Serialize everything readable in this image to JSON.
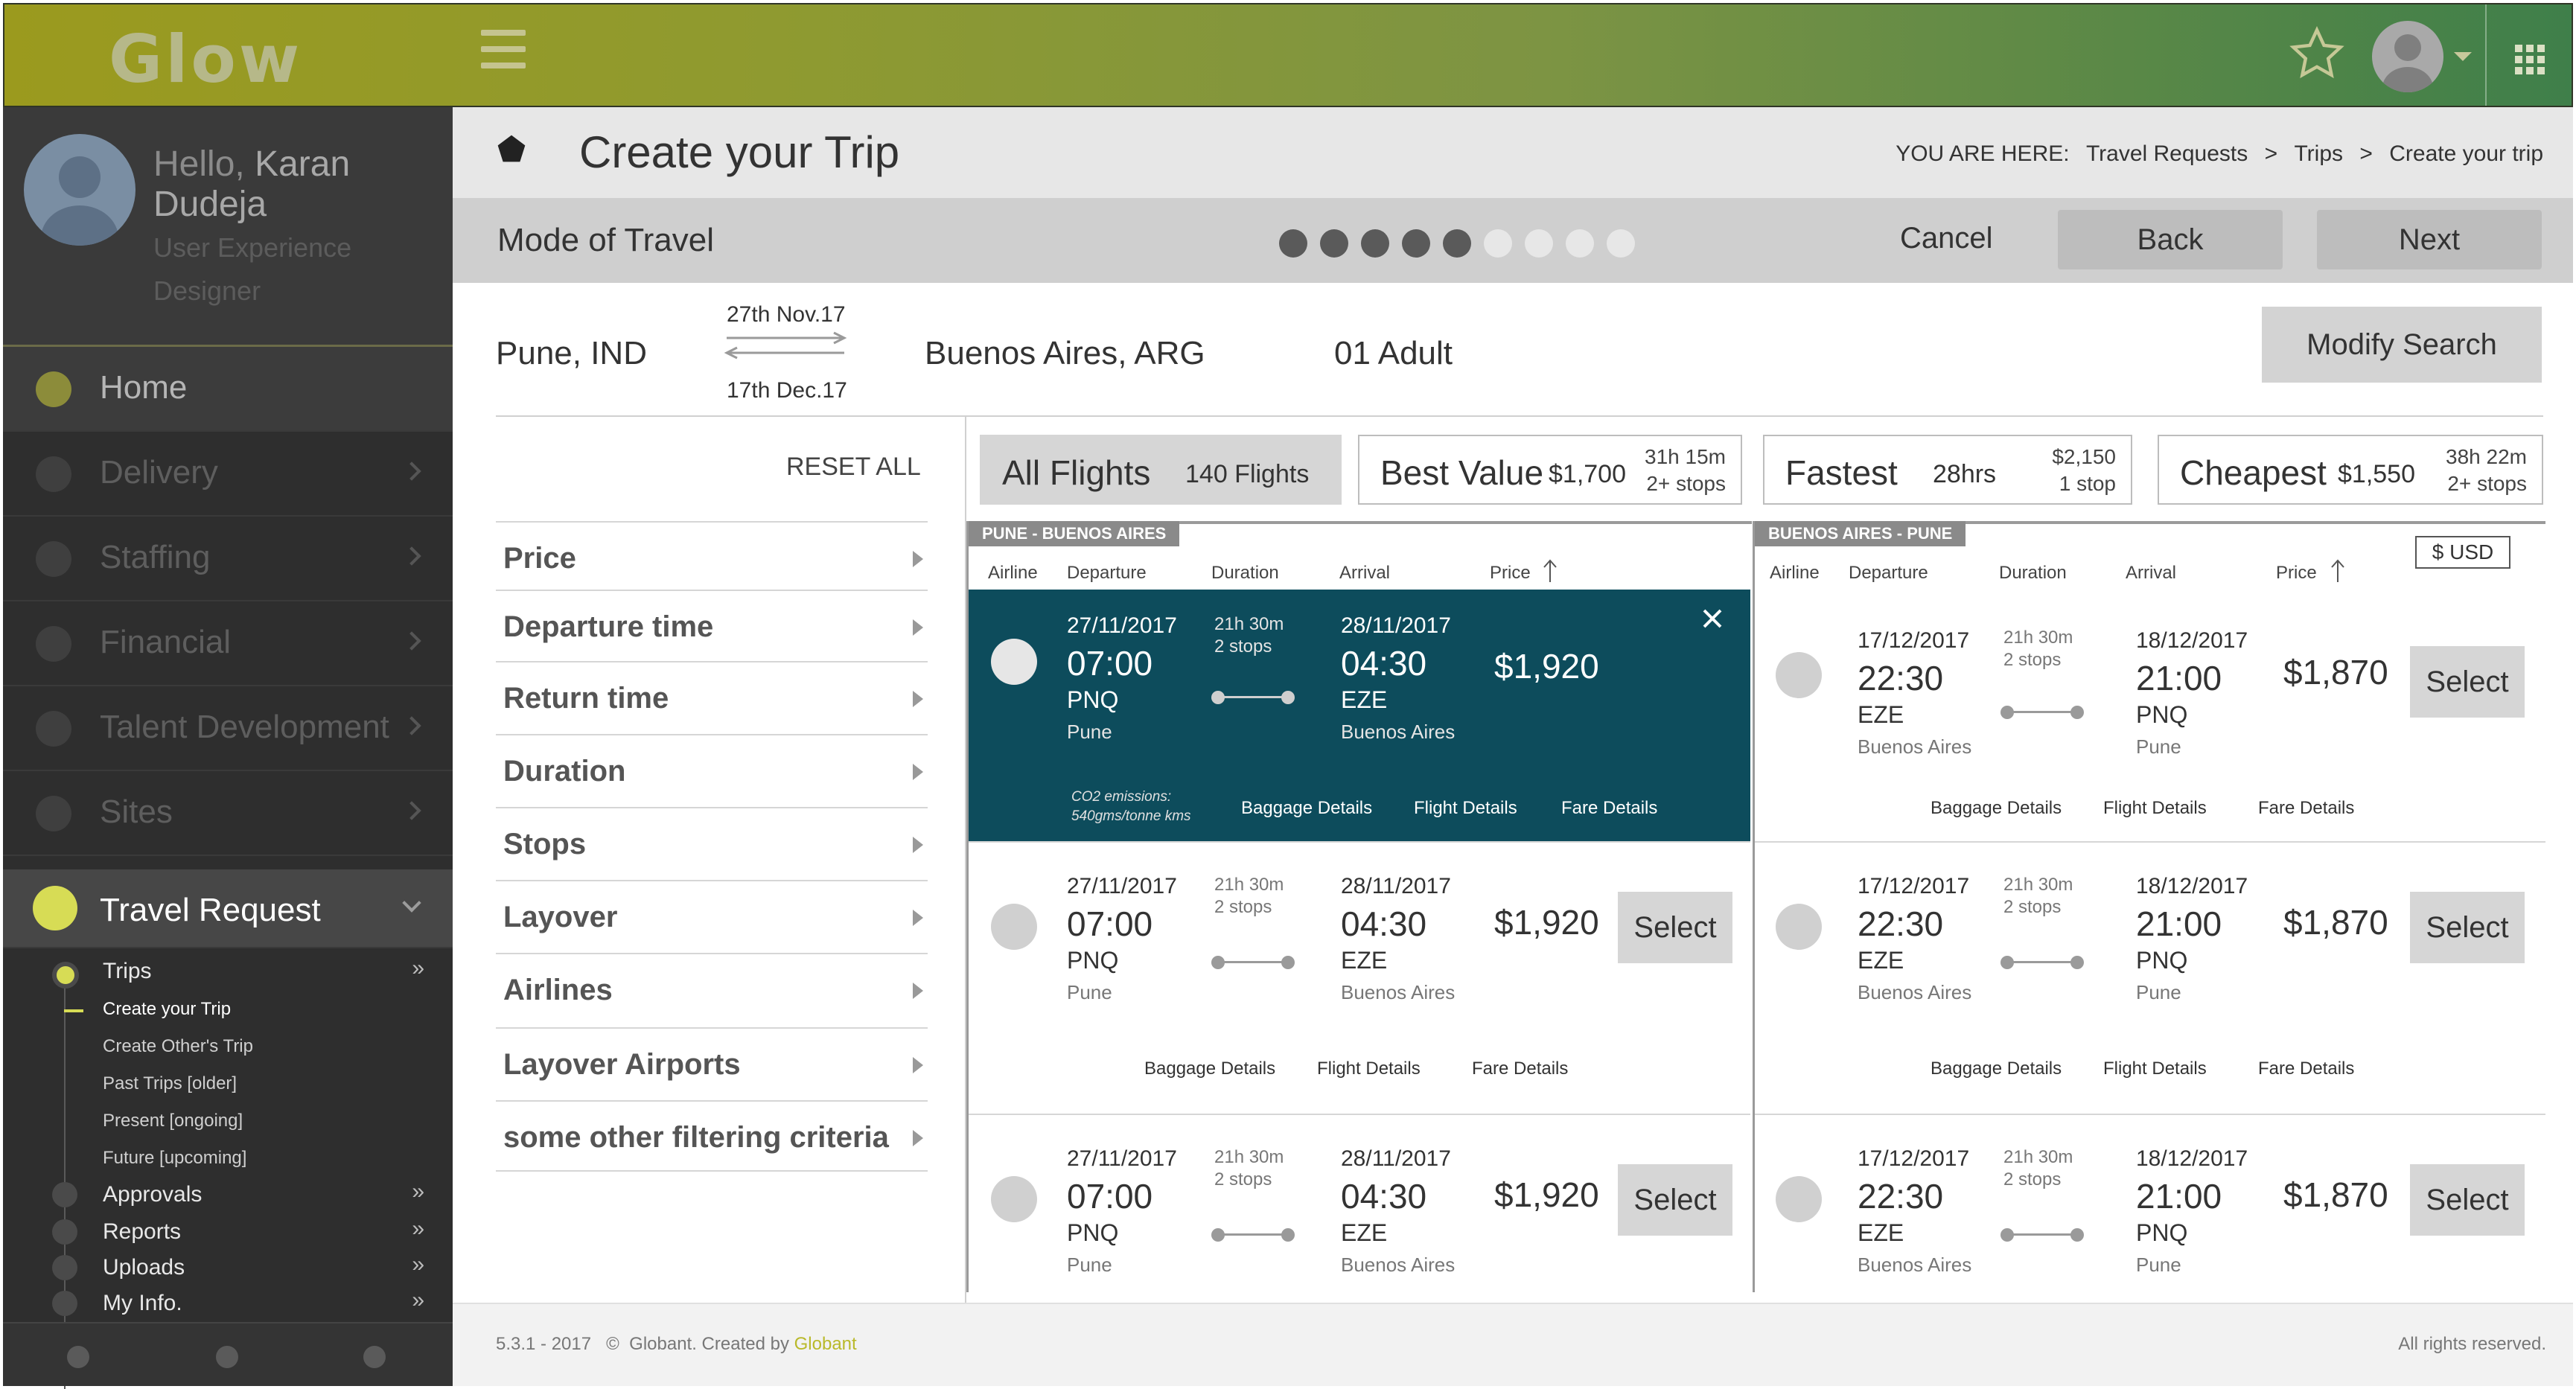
{
  "app": {
    "logo": "Glow"
  },
  "topbar": {
    "icons": [
      "hamburger-icon",
      "star-icon",
      "avatar",
      "apps-grid-icon"
    ]
  },
  "sidebar": {
    "greeting": "Hello,",
    "user_name_first": "Karan",
    "user_name_last": "Dudeja",
    "user_role": "User Experience Designer",
    "nav": [
      {
        "label": "Home",
        "icon": "home-icon"
      },
      {
        "label": "Delivery",
        "icon": "send-icon"
      },
      {
        "label": "Staffing",
        "icon": "people-icon"
      },
      {
        "label": "Financial",
        "icon": "chart-icon"
      },
      {
        "label": "Talent Development",
        "icon": "graduation-icon"
      },
      {
        "label": "Sites",
        "icon": "pin-icon"
      },
      {
        "label": "Travel Request",
        "icon": "pentagon-icon"
      }
    ],
    "sub": {
      "trips": "Trips",
      "create_trip": "Create your Trip",
      "create_others": "Create Other's Trip",
      "past": "Past Trips [older]",
      "present": "Present [ongoing]",
      "future": "Future [upcoming]",
      "approvals": "Approvals",
      "reports": "Reports",
      "uploads": "Uploads",
      "myinfo": "My Info."
    }
  },
  "header": {
    "title": "Create your Trip",
    "crumb_label": "YOU ARE HERE:",
    "crumbs": [
      "Travel Requests",
      "Trips",
      "Create your trip"
    ],
    "crumb_sep": ">"
  },
  "mode": {
    "title": "Mode of Travel",
    "steps_total": 9,
    "steps_done": 5,
    "cancel": "Cancel",
    "back": "Back",
    "next": "Next"
  },
  "search": {
    "from": "Pune, IND",
    "to": "Buenos Aires, ARG",
    "depart_date": "27th Nov.17",
    "return_date": "17th Dec.17",
    "passengers": "01 Adult",
    "modify": "Modify Search"
  },
  "filters": {
    "reset": "RESET ALL",
    "items": [
      "Price",
      "Departure time",
      "Return time",
      "Duration",
      "Stops",
      "Layover",
      "Airlines",
      "Layover Airports",
      "some other filtering criteria"
    ]
  },
  "summary": {
    "all": {
      "label": "All Flights",
      "count": "140 Flights"
    },
    "best": {
      "label": "Best Value",
      "price": "$1,700",
      "duration": "31h 15m",
      "stops": "2+ stops"
    },
    "fastest": {
      "label": "Fastest",
      "duration": "28hrs",
      "price": "$2,150",
      "stops": "1 stop"
    },
    "cheapest": {
      "label": "Cheapest",
      "price": "$1,550",
      "duration": "38h 22m",
      "stops": "2+ stops"
    }
  },
  "columns": {
    "airline": "Airline",
    "departure": "Departure",
    "duration": "Duration",
    "arrival": "Arrival",
    "price": "Price"
  },
  "currency": "$ USD",
  "outbound": {
    "tag": "PUNE - BUENOS AIRES",
    "select": "Select",
    "links": {
      "baggage": "Baggage Details",
      "flight": "Flight Details",
      "fare": "Fare Details"
    },
    "co2_line1": "CO2 emissions:",
    "co2_line2": "540gms/tonne kms",
    "rows": [
      {
        "dep_date": "27/11/2017",
        "dep_time": "07:00",
        "dep_code": "PNQ",
        "dep_city": "Pune",
        "dur": "21h 30m",
        "stops": "2 stops",
        "arr_date": "28/11/2017",
        "arr_time": "04:30",
        "arr_code": "EZE",
        "arr_city": "Buenos Aires",
        "price": "$1,920"
      },
      {
        "dep_date": "27/11/2017",
        "dep_time": "07:00",
        "dep_code": "PNQ",
        "dep_city": "Pune",
        "dur": "21h 30m",
        "stops": "2 stops",
        "arr_date": "28/11/2017",
        "arr_time": "04:30",
        "arr_code": "EZE",
        "arr_city": "Buenos Aires",
        "price": "$1,920"
      },
      {
        "dep_date": "27/11/2017",
        "dep_time": "07:00",
        "dep_code": "PNQ",
        "dep_city": "Pune",
        "dur": "21h 30m",
        "stops": "2 stops",
        "arr_date": "28/11/2017",
        "arr_time": "04:30",
        "arr_code": "EZE",
        "arr_city": "Buenos Aires",
        "price": "$1,920"
      }
    ]
  },
  "inbound": {
    "tag": "BUENOS AIRES - PUNE",
    "select": "Select",
    "links": {
      "baggage": "Baggage Details",
      "flight": "Flight Details",
      "fare": "Fare Details"
    },
    "rows": [
      {
        "dep_date": "17/12/2017",
        "dep_time": "22:30",
        "dep_code": "EZE",
        "dep_city": "Buenos Aires",
        "dur": "21h 30m",
        "stops": "2 stops",
        "arr_date": "18/12/2017",
        "arr_time": "21:00",
        "arr_code": "PNQ",
        "arr_city": "Pune",
        "price": "$1,870"
      },
      {
        "dep_date": "17/12/2017",
        "dep_time": "22:30",
        "dep_code": "EZE",
        "dep_city": "Buenos Aires",
        "dur": "21h 30m",
        "stops": "2 stops",
        "arr_date": "18/12/2017",
        "arr_time": "21:00",
        "arr_code": "PNQ",
        "arr_city": "Pune",
        "price": "$1,870"
      },
      {
        "dep_date": "17/12/2017",
        "dep_time": "22:30",
        "dep_code": "EZE",
        "dep_city": "Buenos Aires",
        "dur": "21h 30m",
        "stops": "2 stops",
        "arr_date": "18/12/2017",
        "arr_time": "21:00",
        "arr_code": "PNQ",
        "arr_city": "Pune",
        "price": "$1,870"
      }
    ]
  },
  "footer": {
    "version": "5.3.1 - 2017",
    "copyright": "©",
    "created": "Globant. Created by",
    "brand": "Globant",
    "rights": "All rights reserved."
  },
  "colors": {
    "accent": "#d7dc55",
    "selected_row": "#0d4c5c",
    "sidebar": "#2e2e2e"
  }
}
